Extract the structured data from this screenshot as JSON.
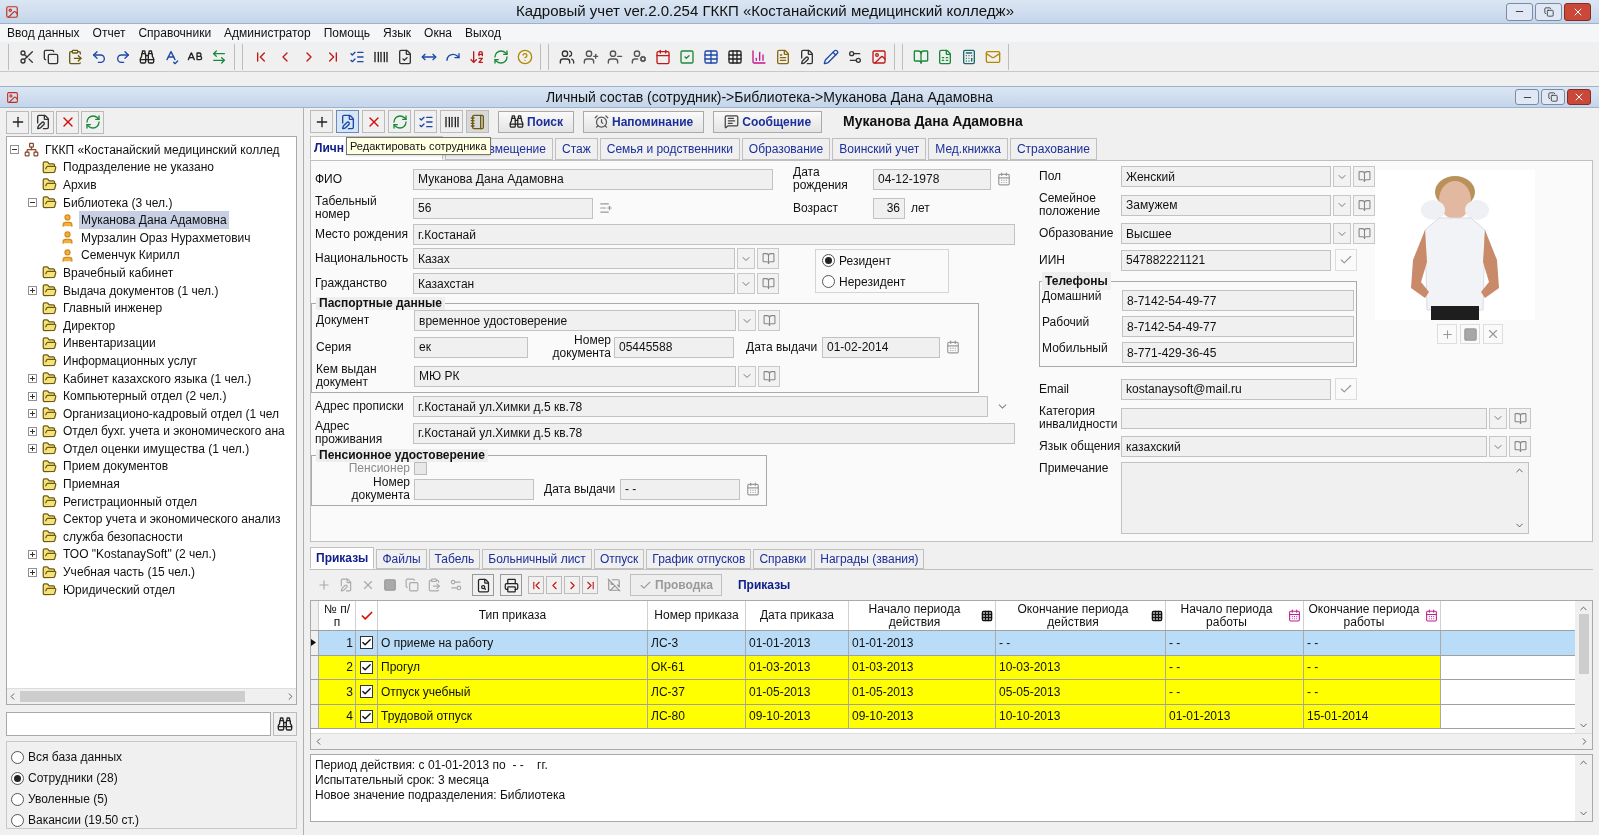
{
  "window": {
    "title": "Кадровый учет ver.2.0.254 ГККП «Костанайский медицинский колледж»"
  },
  "menu": [
    "Ввод данных",
    "Отчет",
    "Справочники",
    "Администратор",
    "Помощь",
    "Язык",
    "Окна",
    "Выход"
  ],
  "child_window": {
    "title": "Личный состав (сотрудник)->Библиотека->Муканова Дана Адамовна"
  },
  "left": {
    "tree": [
      {
        "label": "ГККП «Костанайский медицинский коллед",
        "kind": "root",
        "expanded": true,
        "selected": false,
        "children": [
          {
            "label": "Подразделение не указано",
            "kind": "folder",
            "selected": false
          },
          {
            "label": "Архив",
            "kind": "folder",
            "selected": false
          },
          {
            "label": "Библиотека (3 чел.)",
            "kind": "folder",
            "expanded": true,
            "selected": false,
            "children": [
              {
                "label": "Муканова Дана Адамовна",
                "kind": "person",
                "selected": true
              },
              {
                "label": "Мурзалин Ораз Нурахметович",
                "kind": "person",
                "selected": false
              },
              {
                "label": "Семенчук Кирилл",
                "kind": "person",
                "selected": false
              }
            ]
          },
          {
            "label": "Врачебный кабинет",
            "kind": "folder",
            "selected": false
          },
          {
            "label": "Выдача документов (1 чел.)",
            "kind": "folder",
            "expanded": false,
            "selected": false
          },
          {
            "label": "Главный инженер",
            "kind": "folder",
            "selected": false
          },
          {
            "label": "Директор",
            "kind": "folder",
            "selected": false
          },
          {
            "label": "Инвентаризации",
            "kind": "folder",
            "selected": false
          },
          {
            "label": "Информационных услуг",
            "kind": "folder",
            "selected": false
          },
          {
            "label": "Кабинет казахского языка (1 чел.)",
            "kind": "folder",
            "expanded": false,
            "selected": false
          },
          {
            "label": "Компьютерный отдел (2 чел.)",
            "kind": "folder",
            "expanded": false,
            "selected": false
          },
          {
            "label": "Организационо-кадровый отдел (1 чел",
            "kind": "folder",
            "expanded": false,
            "selected": false
          },
          {
            "label": "Отдел бухг. учета и экономического ана",
            "kind": "folder",
            "expanded": false,
            "selected": false
          },
          {
            "label": "Отдел оценки имущества (1 чел.)",
            "kind": "folder",
            "expanded": false,
            "selected": false
          },
          {
            "label": "Прием документов",
            "kind": "folder",
            "selected": false
          },
          {
            "label": "Приемная",
            "kind": "folder",
            "selected": false
          },
          {
            "label": "Регистрационный отдел",
            "kind": "folder",
            "selected": false
          },
          {
            "label": "Сектор учета и экономического анализ",
            "kind": "folder",
            "selected": false
          },
          {
            "label": "служба безопасности",
            "kind": "folder",
            "selected": false
          },
          {
            "label": "ТОО \"KostanaySoft\" (2 чел.)",
            "kind": "folder",
            "expanded": false,
            "selected": false
          },
          {
            "label": "Учебная часть (15 чел.)",
            "kind": "folder",
            "expanded": false,
            "selected": false
          },
          {
            "label": "Юридический отдел",
            "kind": "folder",
            "selected": false
          }
        ]
      }
    ],
    "filters": [
      {
        "label": "Вся база данных",
        "selected": false
      },
      {
        "label": "Сотрудники (28)",
        "selected": true
      },
      {
        "label": "Уволенные (5)",
        "selected": false
      },
      {
        "label": "Вакансии (19.50 ст.)",
        "selected": false
      }
    ]
  },
  "record": {
    "buttons": [
      {
        "label": "Поиск",
        "kind": "search"
      },
      {
        "label": "Напоминание",
        "kind": "reminder"
      },
      {
        "label": "Сообщение",
        "kind": "message"
      }
    ],
    "heading": "Муканова Дана Адамовна",
    "tooltip": "Редактировать сотрудника",
    "tabs": [
      {
        "label": "Личн",
        "selected": true
      },
      {
        "label": "вмещение",
        "selected": false
      },
      {
        "label": "Стаж",
        "selected": false
      },
      {
        "label": "Семья и родственники",
        "selected": false
      },
      {
        "label": "Образование",
        "selected": false
      },
      {
        "label": "Воинский учет",
        "selected": false
      },
      {
        "label": "Мед.книжка",
        "selected": false
      },
      {
        "label": "Страхование",
        "selected": false
      }
    ]
  },
  "personal": {
    "fio": {
      "label": "ФИО",
      "value": "Муканова Дана Адамовна"
    },
    "birth_date": {
      "label": "Дата рождения",
      "value": "04-12-1978"
    },
    "tab_number": {
      "label": "Табельный номер",
      "value": "56"
    },
    "age": {
      "label": "Возраст",
      "value": "36",
      "unit": "лет"
    },
    "birthplace": {
      "label": "Место рождения",
      "value": "г.Костанай"
    },
    "nationality": {
      "label": "Национальность",
      "value": "Казах"
    },
    "citizenship": {
      "label": "Гражданство",
      "value": "Казахстан"
    },
    "residency": [
      {
        "label": "Резидент",
        "selected": true
      },
      {
        "label": "Нерезидент",
        "selected": false
      }
    ],
    "passport": {
      "title": "Паспортные данные",
      "document": {
        "label": "Документ",
        "value": "временное удостоверение"
      },
      "series": {
        "label": "Серия",
        "value": "ек"
      },
      "number": {
        "label": "Номер документа",
        "value": "05445588"
      },
      "issue_date": {
        "label": "Дата выдачи",
        "value": "01-02-2014"
      },
      "issued_by": {
        "label": "Кем выдан документ",
        "value": "МЮ РК"
      }
    },
    "reg_address": {
      "label": "Адрес прописки",
      "value": "г.Костанай ул.Химки д.5 кв.78"
    },
    "address": {
      "label": "Адрес проживания",
      "value": "г.Костанай ул.Химки д.5 кв.78"
    },
    "pension": {
      "title": "Пенсионное удостоверение",
      "pensioner": {
        "label": "Пенсионер",
        "checked": false,
        "disabled": true
      },
      "number": {
        "label": "Номер документа"
      },
      "issue_date": {
        "label": "Дата выдачи",
        "value": "- -"
      }
    },
    "gender": {
      "label": "Пол",
      "value": "Женский"
    },
    "marital": {
      "label": "Семейное положение",
      "value": "Замужем"
    },
    "education": {
      "label": "Образование",
      "value": "Высшее"
    },
    "iin": {
      "label": "ИИН",
      "value": "547882221121"
    },
    "phones": {
      "title": "Телефоны",
      "items": [
        {
          "label": "Домашний",
          "value": "8-7142-54-49-77"
        },
        {
          "label": "Рабочий",
          "value": "8-7142-54-49-77"
        },
        {
          "label": "Мобильный",
          "value": "8-771-429-36-45"
        }
      ]
    },
    "email": {
      "label": "Email",
      "value": "kostanaysoft@mail.ru"
    },
    "disability": {
      "label": "Категория инвалидности"
    },
    "language": {
      "label": "Язык общения",
      "value": "казахский"
    },
    "note": {
      "label": "Примечание"
    }
  },
  "lower": {
    "tabs": [
      {
        "label": "Приказы",
        "selected": true
      },
      {
        "label": "Файлы",
        "selected": false
      },
      {
        "label": "Табель",
        "selected": false
      },
      {
        "label": "Больничный лист",
        "selected": false
      },
      {
        "label": "Отпуск",
        "selected": false
      },
      {
        "label": "График отпусков",
        "selected": false
      },
      {
        "label": "Справки",
        "selected": false
      },
      {
        "label": "Награды (звания)",
        "selected": false
      }
    ],
    "post_button": {
      "label": "Проводка",
      "disabled": true
    },
    "section_title": "Приказы",
    "table": {
      "columns": [
        {
          "label": "№ п/п",
          "kind": "text"
        },
        {
          "label": "Тип приказа",
          "kind": "text"
        },
        {
          "label": "Номер приказа",
          "kind": "text"
        },
        {
          "label": "Дата приказа",
          "kind": "text"
        },
        {
          "label": "Начало периода действия",
          "kind": "grid"
        },
        {
          "label": "Окончание периода действия",
          "kind": "grid"
        },
        {
          "label": "Начало периода работы",
          "kind": "calendar"
        },
        {
          "label": "Окончание периода работы",
          "kind": "calendar"
        }
      ],
      "rows": [
        {
          "checked": true,
          "cells": [
            "1",
            "О приеме на работу",
            "ЛС-3",
            "01-01-2013",
            "01-01-2013",
            "- -",
            "- -",
            "- -"
          ],
          "selected": true
        },
        {
          "checked": true,
          "cells": [
            "2",
            "Прогул",
            "ОК-61",
            "01-03-2013",
            "01-03-2013",
            "10-03-2013",
            "- -",
            "- -"
          ],
          "selected": false
        },
        {
          "checked": true,
          "cells": [
            "3",
            "Отпуск учебный",
            "ЛС-37",
            "01-05-2013",
            "01-05-2013",
            "05-05-2013",
            "- -",
            "- -"
          ],
          "selected": false
        },
        {
          "checked": true,
          "cells": [
            "4",
            "Трудовой отпуск",
            "ЛС-80",
            "09-10-2013",
            "09-10-2013",
            "10-10-2013",
            "01-01-2013",
            "15-01-2014"
          ],
          "selected": false
        }
      ]
    },
    "details": [
      "Период действия: с 01-01-2013 по  - -    гг.",
      "Испытательный срок: 3 месяца",
      "Новое значение подразделения: Библиотека"
    ]
  }
}
